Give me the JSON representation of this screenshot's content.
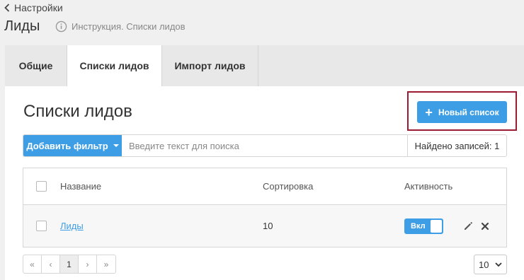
{
  "header": {
    "back_label": "Настройки",
    "title": "Лиды",
    "instruction_label": "Инструкция. Списки лидов"
  },
  "tabs": [
    {
      "label": "Общие",
      "active": false
    },
    {
      "label": "Списки лидов",
      "active": true
    },
    {
      "label": "Импорт лидов",
      "active": false
    }
  ],
  "main": {
    "title": "Списки лидов",
    "new_list_label": "Новый список",
    "filter_label": "Добавить фильтр",
    "search_placeholder": "Введите текст для поиска",
    "found_label": "Найдено записей: 1"
  },
  "table": {
    "columns": [
      "Название",
      "Сортировка",
      "Активность"
    ],
    "rows": [
      {
        "name": "Лиды",
        "sort": "10",
        "active_label": "Вкл",
        "active": true
      }
    ]
  },
  "pagination": {
    "first": "«",
    "prev": "‹",
    "current": "1",
    "next": "›",
    "last": "»",
    "per_page": "10"
  },
  "colors": {
    "accent": "#3d9ee5",
    "highlight": "#9b1b30"
  }
}
